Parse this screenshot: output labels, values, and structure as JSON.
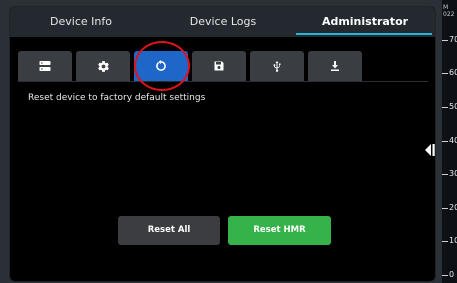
{
  "tabs": [
    {
      "label": "Device Info"
    },
    {
      "label": "Device Logs"
    },
    {
      "label": "Administrator",
      "active": true
    }
  ],
  "icon_tabs": [
    {
      "icon": "server-icon",
      "active": false
    },
    {
      "icon": "gear-icon",
      "active": false
    },
    {
      "icon": "reset-icon",
      "active": true
    },
    {
      "icon": "save-icon",
      "active": false
    },
    {
      "icon": "usb-icon",
      "active": false
    },
    {
      "icon": "download-icon",
      "active": false
    }
  ],
  "content": {
    "description": "Reset device to factory default settings"
  },
  "buttons": {
    "reset_all": "Reset All",
    "reset_hmr": "Reset HMR"
  },
  "background_axis": {
    "header_line1": "M",
    "header_line2": "022",
    "ticks": [
      "70",
      "60",
      "50",
      "40",
      "30",
      "20",
      "10",
      "0"
    ]
  },
  "colors": {
    "accent": "#21b7d6",
    "active_tab": "#1e66c8",
    "reset_hmr": "#36b24a",
    "reset_all": "#3b3d40",
    "highlight": "#e0121a"
  }
}
